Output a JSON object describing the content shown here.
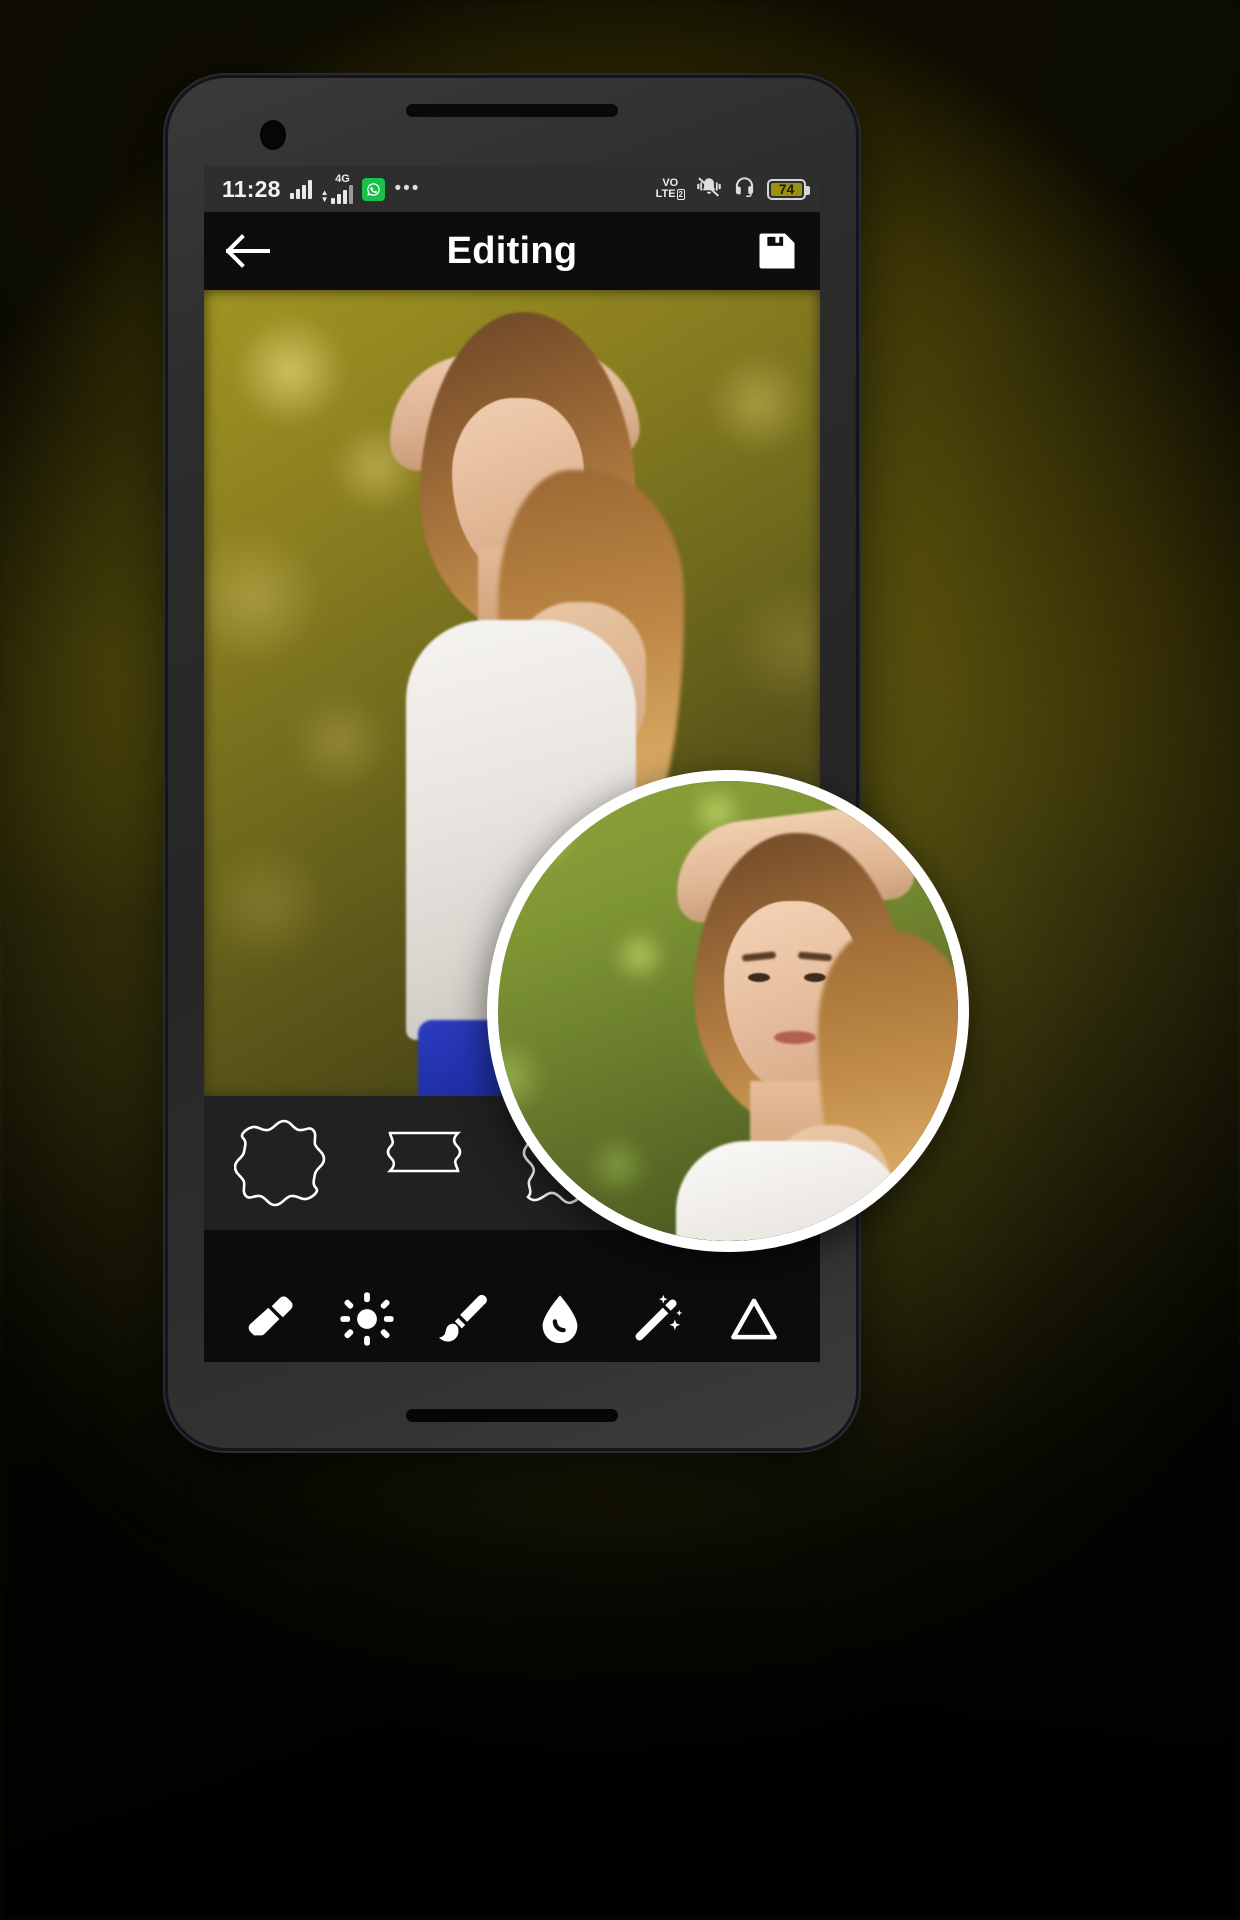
{
  "app": {
    "title": "Editing"
  },
  "status_bar": {
    "time": "11:28",
    "signal_icon": "signal-bars-icon",
    "data_network": "4G",
    "data_up_arrow": "▲",
    "data_down_arrow": "▼",
    "whatsapp_icon": "whatsapp-icon",
    "whatsapp_glyph": "✆",
    "overflow": "•••",
    "volte_line1": "VO",
    "volte_line2": "LTE",
    "volte_sim": "2",
    "mute_icon": "bell-muted-icon",
    "headphones_icon": "headphones-icon",
    "battery_level": "74",
    "battery_color": "#9b9010"
  },
  "app_bar": {
    "back_icon": "back-arrow-icon",
    "save_icon": "save-floppy-icon"
  },
  "canvas": {
    "photo_alt": "portrait-photo-woman"
  },
  "magnifier": {
    "label": "magnified-preview",
    "border_color": "#ffffff"
  },
  "shape_strip": {
    "shapes": [
      {
        "name": "shape-scalloped-quatrefoil",
        "label": "Scalloped"
      },
      {
        "name": "shape-rounded-banner",
        "label": "Banner"
      },
      {
        "name": "shape-wavy-square",
        "label": "Wavy"
      }
    ]
  },
  "tools": {
    "items": [
      {
        "name": "tool-eraser",
        "icon": "eraser-icon",
        "label": "Eraser"
      },
      {
        "name": "tool-brightness",
        "icon": "sun-icon",
        "label": "Brightness"
      },
      {
        "name": "tool-brush",
        "icon": "paintbrush-icon",
        "label": "Brush"
      },
      {
        "name": "tool-blur",
        "icon": "water-drop-icon",
        "label": "Blur"
      },
      {
        "name": "tool-magic",
        "icon": "magic-wand-icon",
        "label": "Magic"
      },
      {
        "name": "tool-gradient",
        "icon": "triangle-icon",
        "label": "Gradient"
      }
    ]
  },
  "device": {
    "camera": "front-camera",
    "earpiece": "earpiece-speaker",
    "bottom_speaker": "bottom-speaker"
  }
}
